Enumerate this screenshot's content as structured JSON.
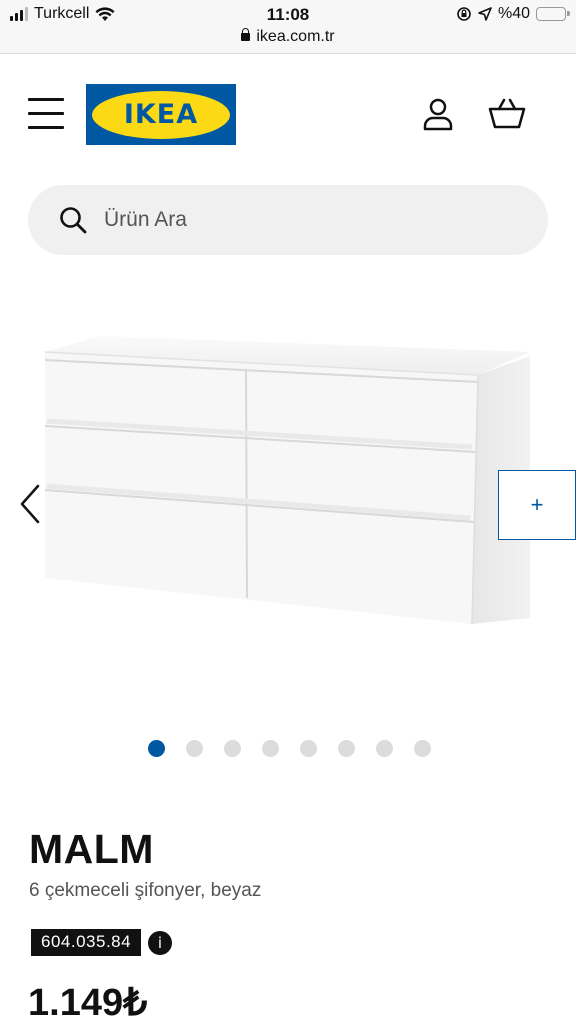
{
  "status_bar": {
    "carrier": "Turkcell",
    "time": "11:08",
    "url": "ikea.com.tr",
    "battery": "%40",
    "battery_level": 0.4
  },
  "header": {
    "logo_text": "IKEA",
    "brand_colors": {
      "blue": "#0058a3",
      "yellow": "#fbd914"
    },
    "icons": [
      "menu-icon",
      "user-icon",
      "basket-icon"
    ]
  },
  "search": {
    "placeholder": "Ürün Ara"
  },
  "gallery": {
    "plus_label": "+",
    "image_count": 8,
    "active_index": 0
  },
  "product": {
    "name": "MALM",
    "description": "6 çekmeceli şifonyer, beyaz",
    "article_number": "604.035.84",
    "info_label": "i",
    "price": "1.149₺"
  }
}
